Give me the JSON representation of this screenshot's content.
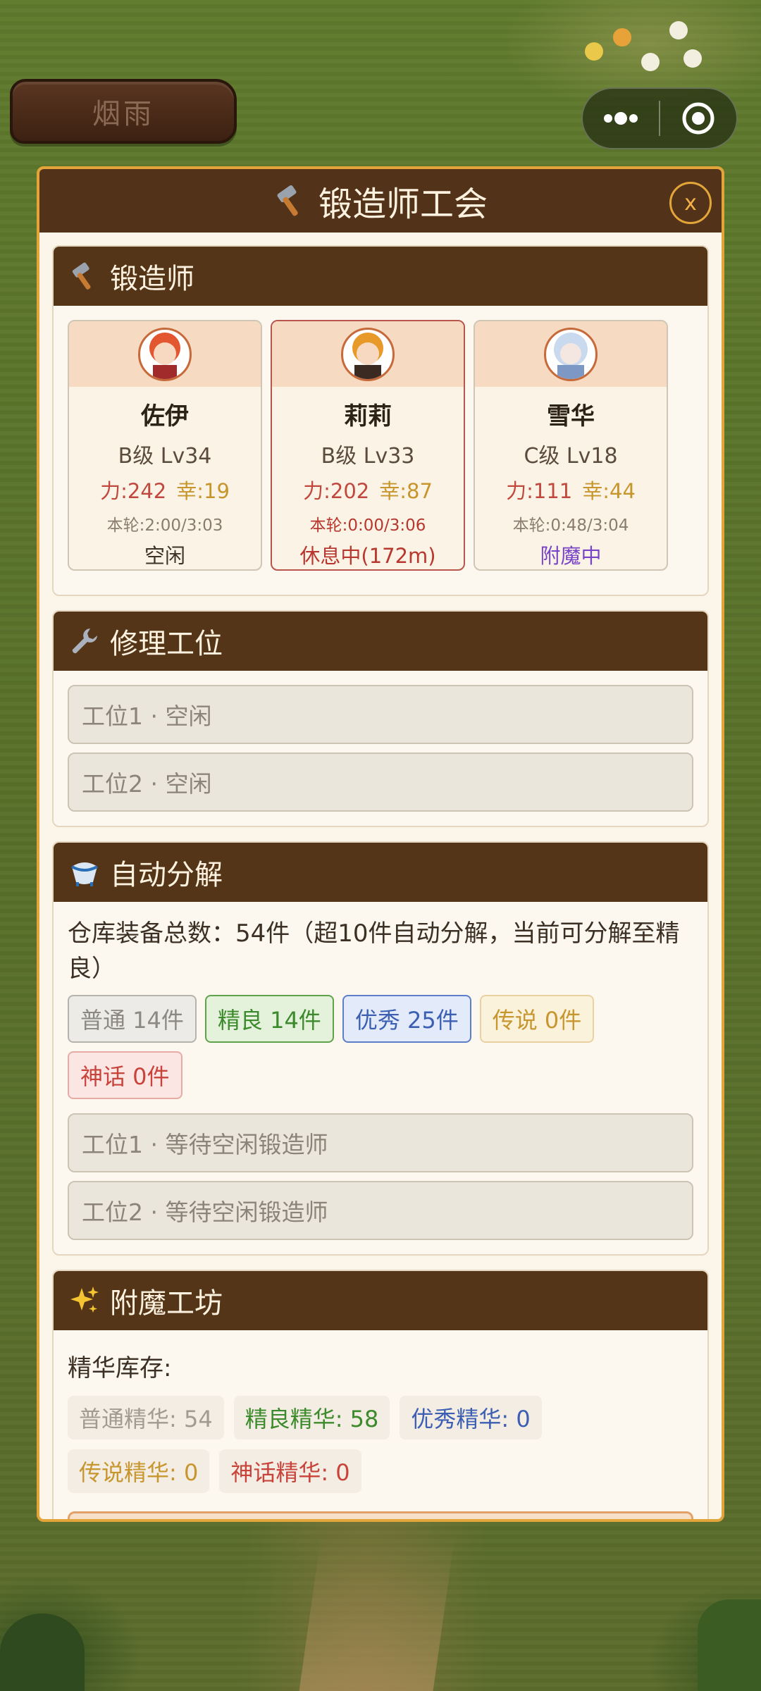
{
  "top": {
    "sign_text": "烟雨"
  },
  "modal": {
    "title": "锻造师工会",
    "close_label": "x"
  },
  "smiths_section": {
    "title": "锻造师",
    "smiths": [
      {
        "name": "佐伊",
        "grade": "B级 Lv34",
        "power": "力:242",
        "luck": "幸:19",
        "round": "本轮:2:00/3:03",
        "state": "空闲"
      },
      {
        "name": "莉莉",
        "grade": "B级 Lv33",
        "power": "力:202",
        "luck": "幸:87",
        "round": "本轮:0:00/3:06",
        "state": "休息中(172m)"
      },
      {
        "name": "雪华",
        "grade": "C级 Lv18",
        "power": "力:111",
        "luck": "幸:44",
        "round": "本轮:0:48/3:04",
        "state": "附魔中"
      }
    ]
  },
  "repair_section": {
    "title": "修理工位",
    "slots": [
      "工位1 · 空闲",
      "工位2 · 空闲"
    ]
  },
  "decompose_section": {
    "title": "自动分解",
    "info": "仓库装备总数：54件（超10件自动分解，当前可分解至精良）",
    "chips": [
      "普通 14件",
      "精良 14件",
      "优秀 25件",
      "传说 0件",
      "神话 0件"
    ],
    "slots": [
      "工位1 · 等待空闲锻造师",
      "工位2 · 等待空闲锻造师"
    ]
  },
  "enchant_section": {
    "title": "附魔工坊",
    "essence_label": "精华库存:",
    "essences": [
      "普通精华: 54",
      "精良精华: 58",
      "优秀精华: 0",
      "传说精华: 0",
      "神话精华: 0"
    ]
  },
  "colors": {
    "header_brown": "#553518",
    "frame_orange": "#e3a53a",
    "power_red": "#c0483f",
    "luck_gold": "#c7952b",
    "enchant_purple": "#7a44c7"
  }
}
